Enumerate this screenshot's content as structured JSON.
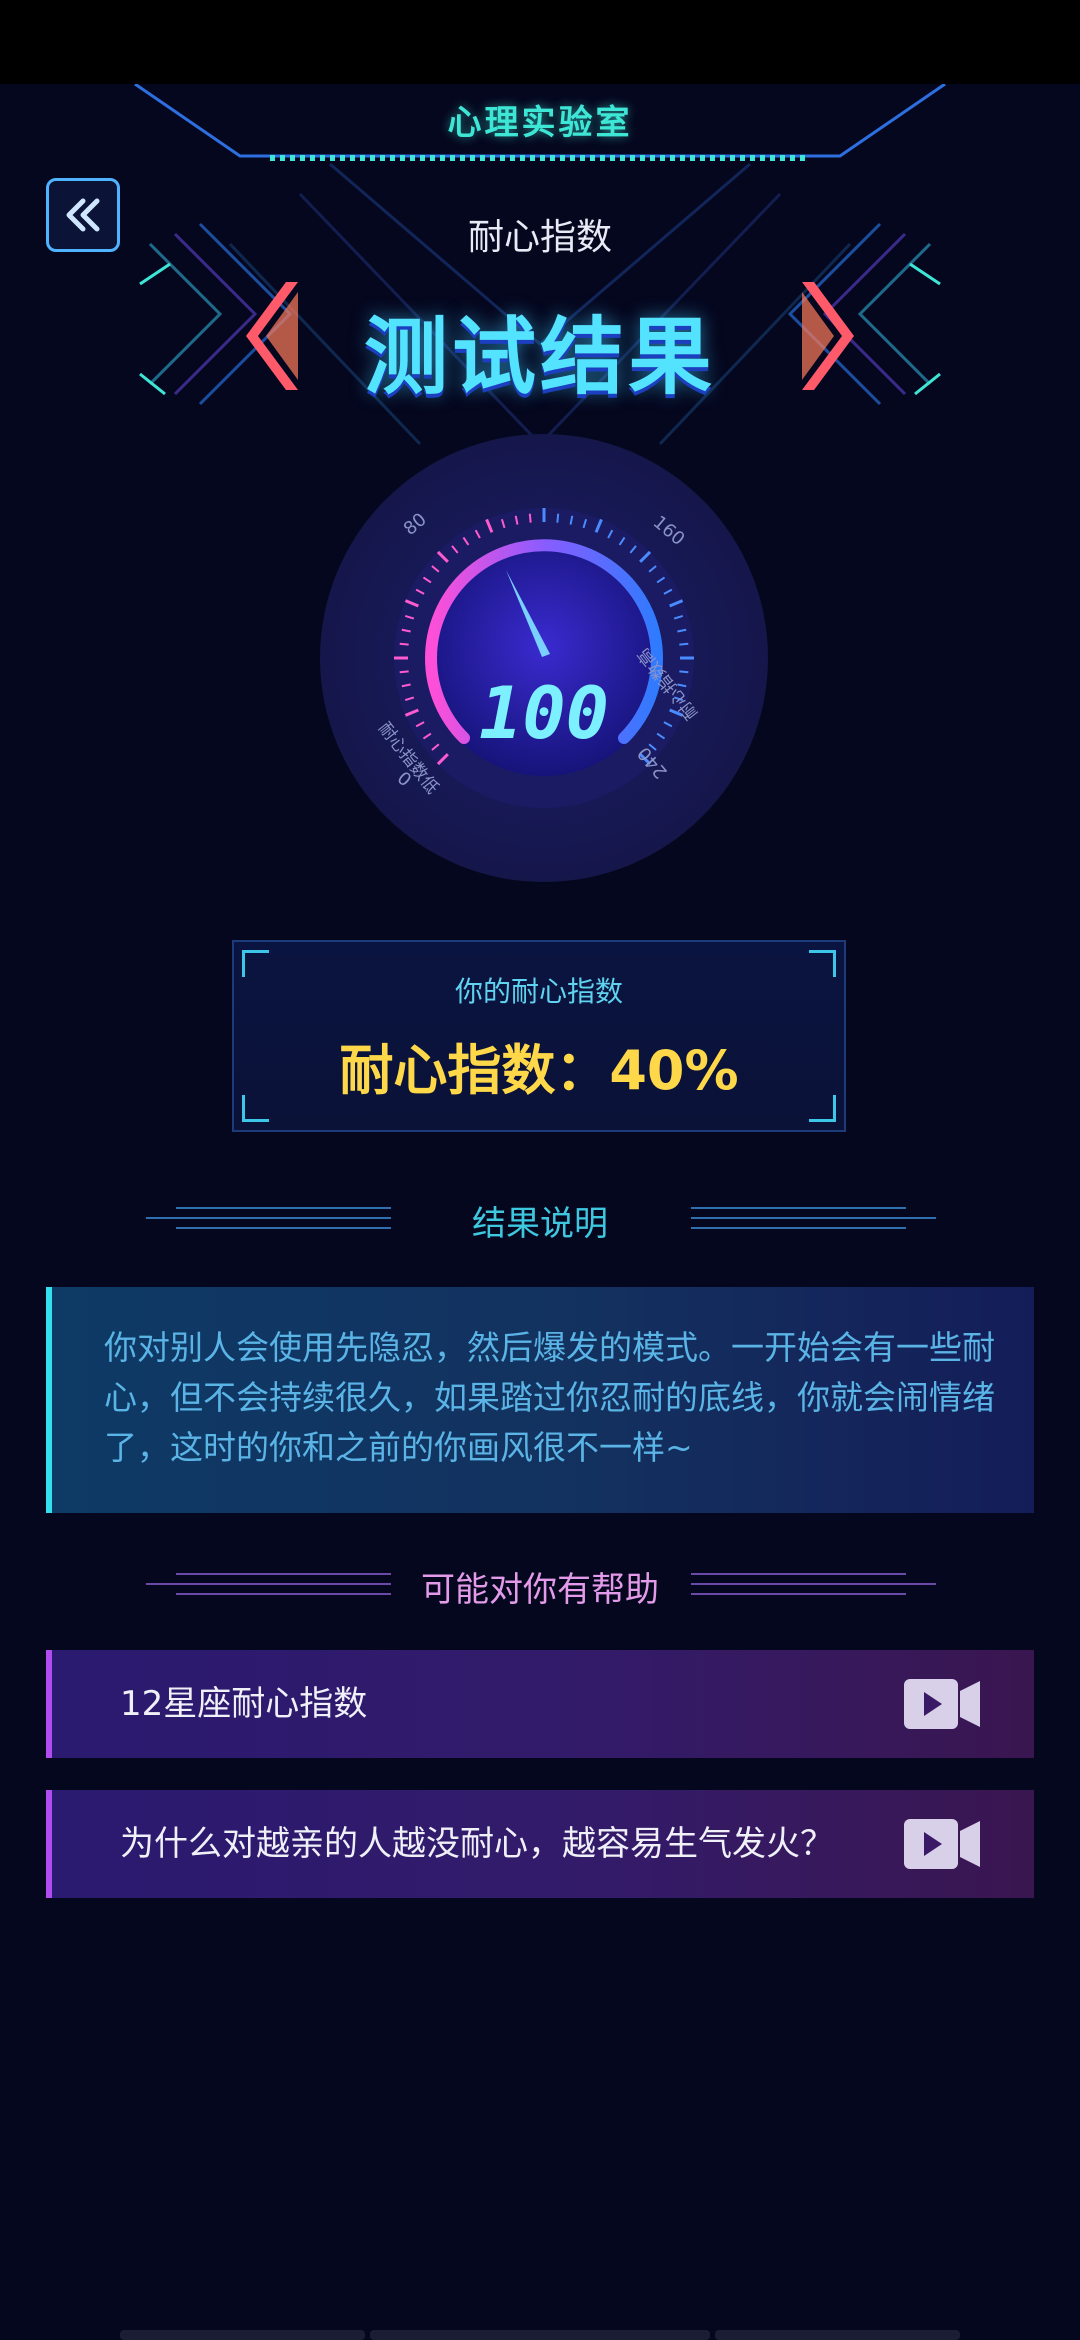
{
  "app": {
    "title": "心理实验室"
  },
  "header": {
    "back_icon": "double-chevron-left-icon",
    "subtitle": "耐心指数",
    "result_title": "测试结果"
  },
  "gauge": {
    "reading": "100",
    "tick_labels": [
      "0",
      "80",
      "160",
      "240"
    ],
    "label_left": "耐心指数低",
    "label_right": "耐心指数高"
  },
  "score": {
    "label": "你的耐心指数",
    "value": "耐心指数：40%"
  },
  "explanation": {
    "title": "结果说明",
    "text": "你对别人会使用先隐忍，然后爆发的模式。一开始会有一些耐心，但不会持续很久，如果踏过你忍耐的底线，你就会闹情绪了，这时的你和之前的你画风很不一样~"
  },
  "help": {
    "title": "可能对你有帮助",
    "items": [
      {
        "label": "12星座耐心指数",
        "icon": "video-icon"
      },
      {
        "label": "为什么对越亲的人越没耐心，越容易生气发火？",
        "icon": "video-icon"
      }
    ]
  },
  "colors": {
    "background": "#05071e",
    "accent_cyan": "#3ee6d6",
    "score_yellow": "#ffd84a",
    "help_purple": "#b14df0"
  }
}
